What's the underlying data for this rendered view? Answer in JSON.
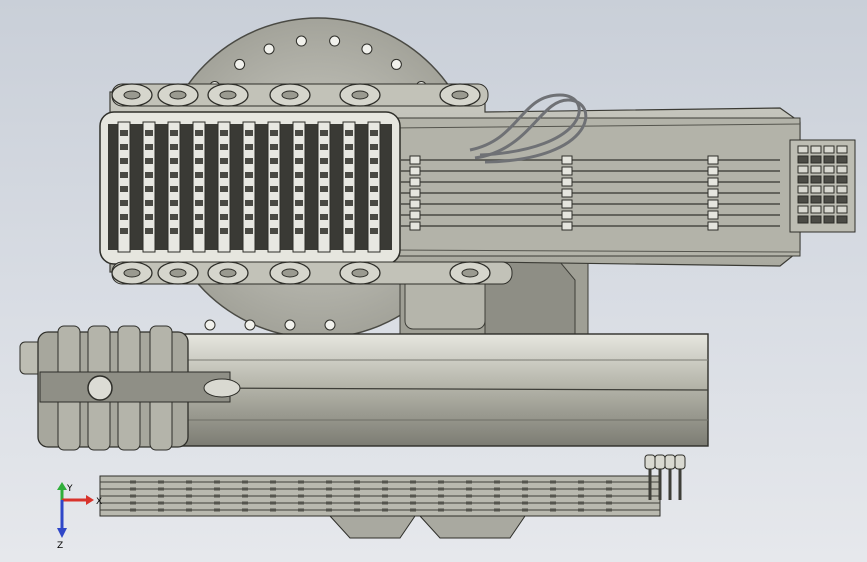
{
  "viewport": {
    "background_top": "#c9cfd8",
    "background_bottom": "#e6e8ec"
  },
  "model": {
    "body_color": "#b9b9ae",
    "dark_color": "#5c5c55",
    "light_color": "#e3e3dc",
    "slider_slats": 11,
    "hose_color": "#cfd2d6"
  },
  "triad": {
    "x_label": "X",
    "y_label": "Y",
    "z_label": "Z",
    "x_color": "#d8332c",
    "y_color": "#2fae3a",
    "z_color": "#2f47c8"
  }
}
